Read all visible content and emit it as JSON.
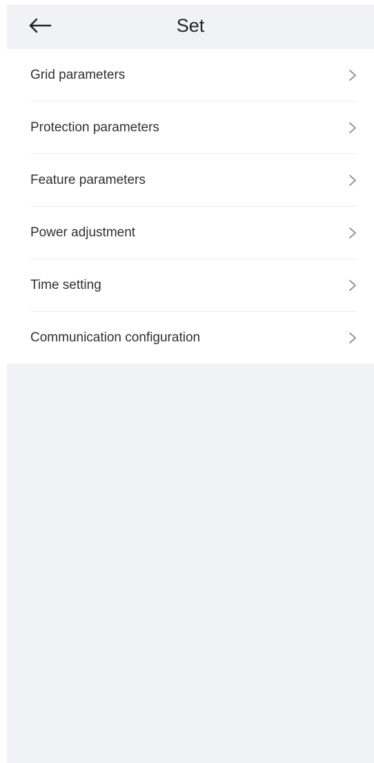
{
  "header": {
    "title": "Set",
    "back_icon": "arrow-left-icon"
  },
  "menu": {
    "items": [
      {
        "label": "Grid parameters",
        "icon": "chevron-right-icon"
      },
      {
        "label": "Protection parameters",
        "icon": "chevron-right-icon"
      },
      {
        "label": "Feature parameters",
        "icon": "chevron-right-icon"
      },
      {
        "label": "Power adjustment",
        "icon": "chevron-right-icon"
      },
      {
        "label": "Time setting",
        "icon": "chevron-right-icon"
      },
      {
        "label": "Communication configuration",
        "icon": "chevron-right-icon"
      }
    ]
  },
  "colors": {
    "page_background": "#f1f2f6",
    "card_background": "#ffffff",
    "text": "#2e3033",
    "chevron": "#8a8c90",
    "divider": "#ececef"
  }
}
